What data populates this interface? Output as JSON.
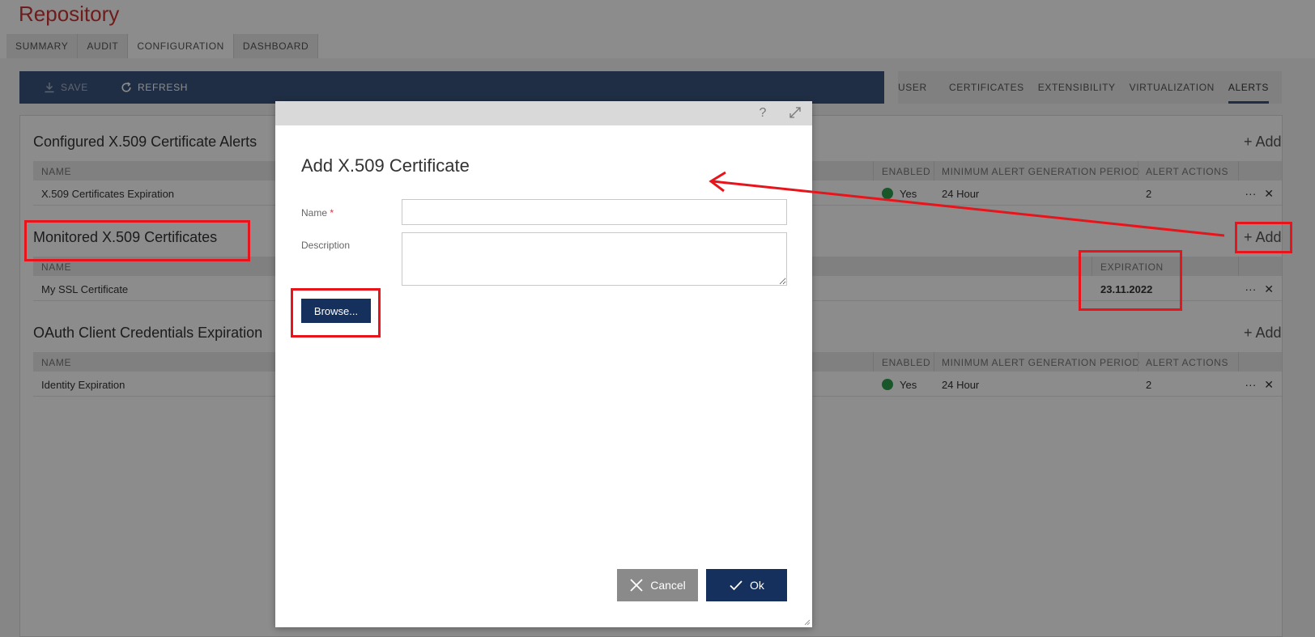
{
  "app": {
    "title": "Repository"
  },
  "tabs": [
    {
      "label": "SUMMARY"
    },
    {
      "label": "AUDIT"
    },
    {
      "label": "CONFIGURATION"
    },
    {
      "label": "DASHBOARD"
    }
  ],
  "toolbar": {
    "save_label": "SAVE",
    "refresh_label": "REFRESH"
  },
  "config_tabs": [
    {
      "label": "USER ROLES"
    },
    {
      "label": "CERTIFICATES"
    },
    {
      "label": "EXTENSIBILITY"
    },
    {
      "label": "VIRTUALIZATION"
    },
    {
      "label": "ALERTS"
    }
  ],
  "sections": {
    "configured": {
      "title": "Configured X.509 Certificate Alerts",
      "add_label": "+ Add",
      "columns": [
        "NAME",
        "ENABLED",
        "MINIMUM ALERT GENERATION PERIOD",
        "ALERT ACTIONS"
      ],
      "row": {
        "name": "X.509 Certificates Expiration",
        "enabled": "Yes",
        "period": "24 Hour",
        "actions": "2"
      }
    },
    "monitored": {
      "title": "Monitored X.509 Certificates",
      "add_label": "+ Add",
      "columns": [
        "NAME",
        "EXPIRATION"
      ],
      "row": {
        "name": "My SSL Certificate",
        "expiration": "23.11.2022"
      }
    },
    "oauth": {
      "title": "OAuth Client Credentials Expiration",
      "add_label": "+ Add",
      "columns": [
        "NAME",
        "ENABLED",
        "MINIMUM ALERT GENERATION PERIOD",
        "ALERT ACTIONS"
      ],
      "row": {
        "name": "Identity Expiration",
        "enabled": "Yes",
        "period": "24 Hour",
        "actions": "2"
      }
    }
  },
  "row_actions": {
    "more": "···",
    "remove": "✕"
  },
  "dialog": {
    "title": "Add X.509 Certificate",
    "help_glyph": "?",
    "name_label": "Name",
    "required_mark": "*",
    "name_value": "",
    "description_label": "Description",
    "description_value": "",
    "browse_label": "Browse...",
    "cancel_label": "Cancel",
    "ok_label": "Ok"
  },
  "colors": {
    "accent": "#3b557f",
    "primary_button": "#15305d",
    "annotation": "#e8141b",
    "enabled_dot": "#2e9e4f",
    "app_title": "#cc3333"
  }
}
